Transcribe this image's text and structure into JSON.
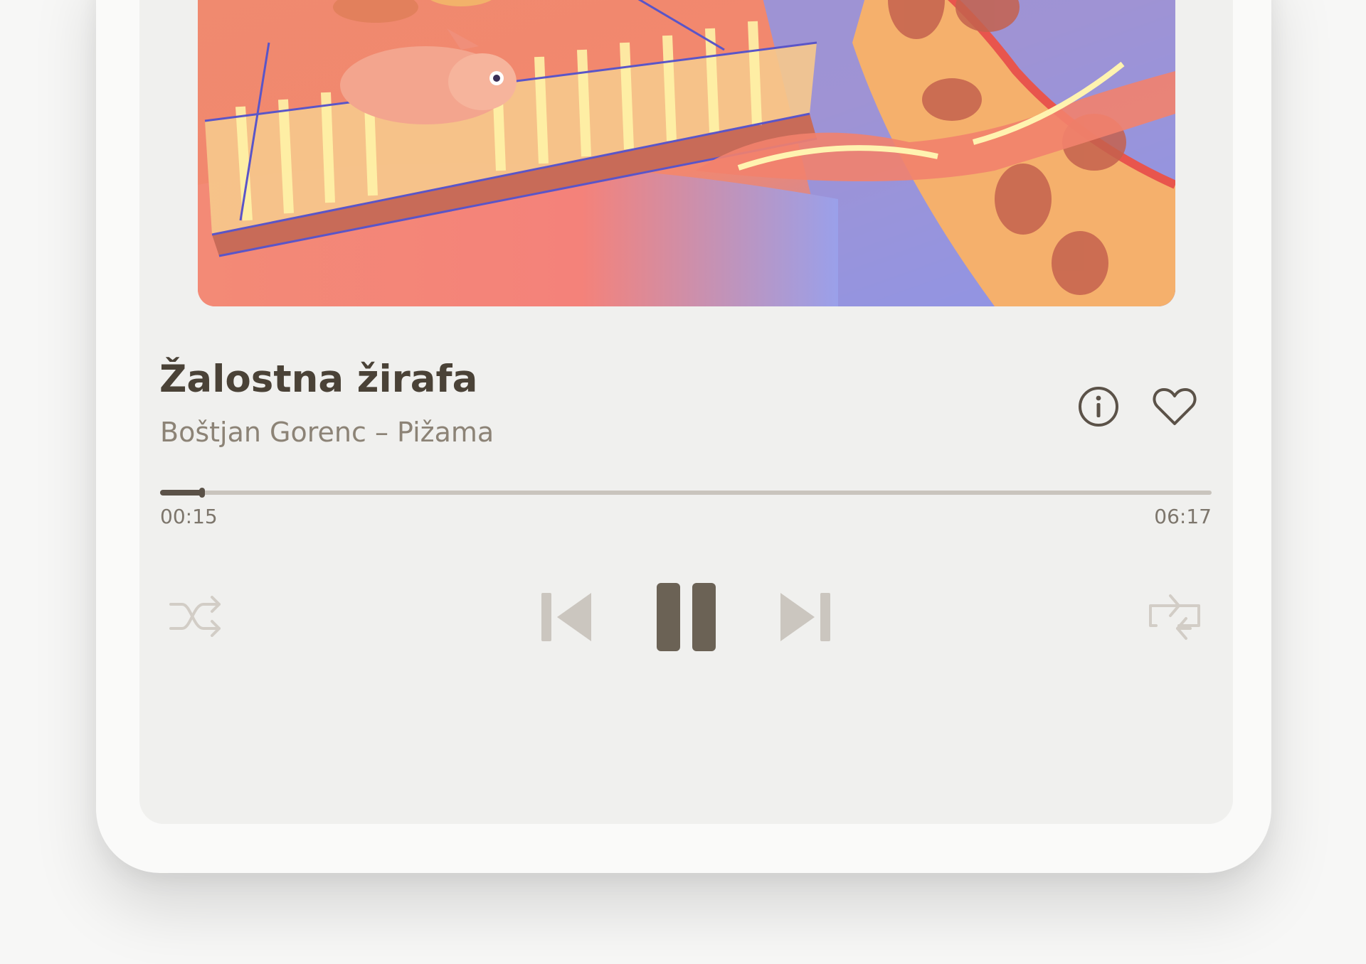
{
  "track": {
    "title": "Žalostna žirafa",
    "subtitle": "Boštjan Gorenc – Pižama"
  },
  "progress": {
    "elapsed": "00:15",
    "total": "06:17",
    "fraction": 0.04
  },
  "icons": {
    "info": "info-circle-icon",
    "favorite": "heart-outline-icon",
    "shuffle": "shuffle-icon",
    "previous": "skip-previous-icon",
    "pause": "pause-icon",
    "next": "skip-next-icon",
    "repeat": "repeat-icon"
  },
  "colors": {
    "primary": "#5b5248",
    "title": "#4a4237",
    "subtitle": "#8c8376",
    "inactive": "#cbc6bf",
    "panel": "#f0f0ee"
  }
}
